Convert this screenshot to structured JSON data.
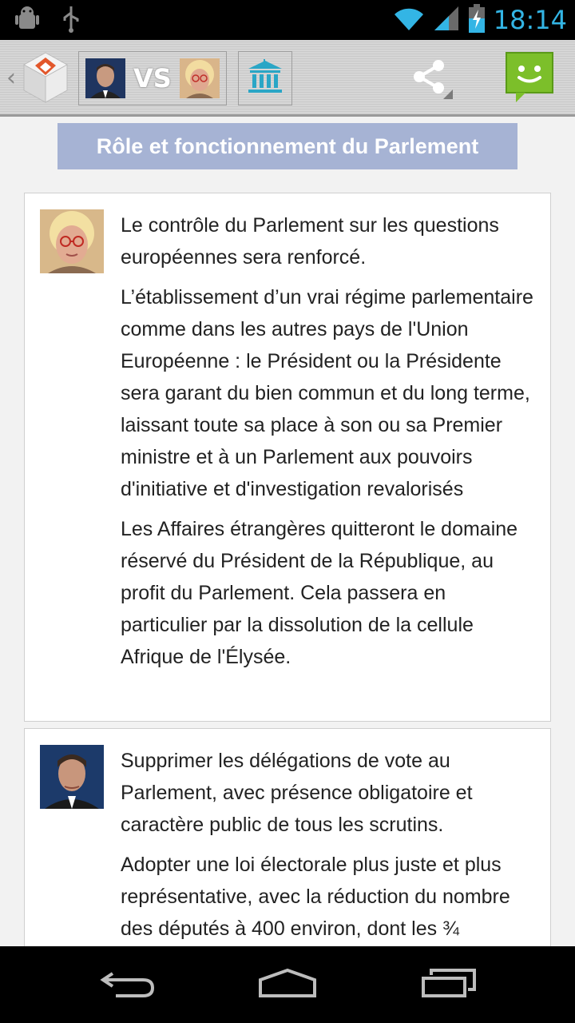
{
  "status_bar": {
    "time": "18:14",
    "icons": [
      "android-debug-icon",
      "usb-icon",
      "wifi-icon",
      "signal-icon",
      "battery-charging-icon"
    ],
    "accent": "#33b5e5"
  },
  "action_bar": {
    "icons": [
      "up-caret-icon",
      "app-logo-icon",
      "candidate-avatar-left",
      "candidate-avatar-right",
      "parliament-icon",
      "share-icon",
      "chat-smiley-icon"
    ],
    "vs_label": "VS"
  },
  "topic": {
    "title": "Rôle et fonctionnement du Parlement",
    "color": "#a6b3d4"
  },
  "cards": [
    {
      "avatar": "candidate-avatar-female",
      "paragraphs": [
        "Le contrôle du Parlement sur les questions européennes sera renforcé.",
        "L’établissement d’un vrai régime parlementaire comme dans les autres pays de l'Union Européenne : le Président ou la Présidente sera garant du bien commun et du long terme, laissant toute sa place à son ou sa Premier ministre et à un Parlement aux pouvoirs d'initiative et d'investigation revalorisés",
        "Les Affaires étrangères quitteront le domaine réservé du Président de la République, au profit du Parlement. Cela passera en particulier par la dissolution de la cellule Afrique de l'Élysée."
      ]
    },
    {
      "avatar": "candidate-avatar-male",
      "paragraphs": [
        "Supprimer les délégations de vote au Parlement, avec présence obligatoire et caractère public de tous les scrutins.",
        "Adopter une loi électorale plus juste et plus représentative, avec la réduction du nombre des députés à 400 environ, dont les ¾"
      ]
    }
  ],
  "nav_bar": {
    "icons": [
      "back-icon",
      "home-icon",
      "recent-apps-icon"
    ]
  }
}
